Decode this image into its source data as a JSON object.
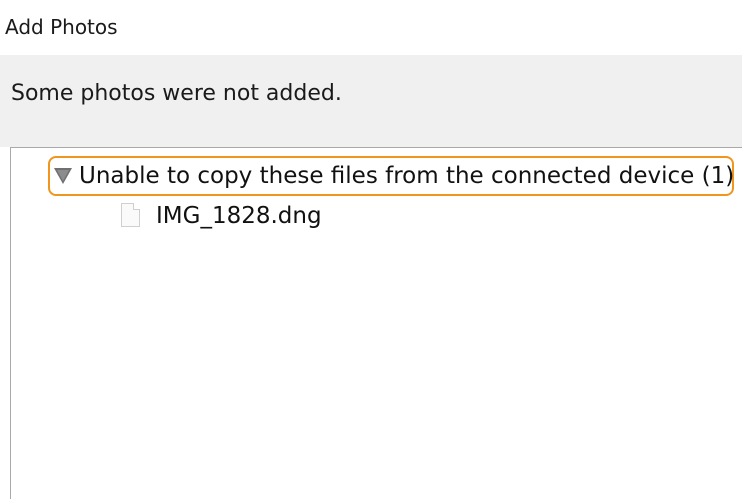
{
  "window": {
    "title": "Add Photos"
  },
  "header": {
    "message": "Some photos were not added."
  },
  "tree": {
    "group": {
      "label": "Unable to copy these files from the connected device (1)",
      "expanded": true,
      "highlight_color": "#f0961e"
    },
    "files": [
      {
        "name": "IMG_1828.dng",
        "icon": "file-icon"
      }
    ]
  }
}
